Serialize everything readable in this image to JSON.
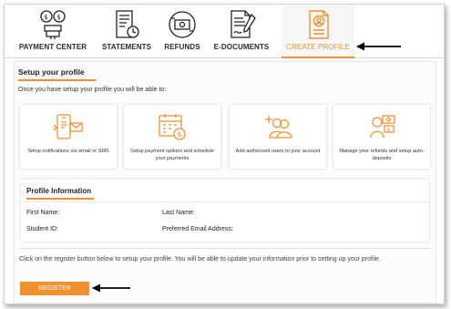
{
  "tabs": [
    {
      "label": "PAYMENT CENTER",
      "icon": "payment-center-icon"
    },
    {
      "label": "STATEMENTS",
      "icon": "statements-icon"
    },
    {
      "label": "REFUNDS",
      "icon": "refunds-icon"
    },
    {
      "label": "E-DOCUMENTS",
      "icon": "e-documents-icon"
    },
    {
      "label": "CREATE PROFILE",
      "icon": "create-profile-icon",
      "active": true
    }
  ],
  "setup": {
    "title": "Setup your profile",
    "intro": "Once you have setup your profile you will be able to:",
    "cards": [
      {
        "text": "Setup notifications via email or SMS",
        "icon": "notifications-icon"
      },
      {
        "text": "Setup payment options and schedule your payments",
        "icon": "calendar-payment-icon"
      },
      {
        "text": "Add authorized users to your account",
        "icon": "add-users-icon"
      },
      {
        "text": "Manage your refunds and setup auto-deposits",
        "icon": "refund-manage-icon"
      }
    ]
  },
  "profile": {
    "title": "Profile Information",
    "first_name": "First Name:",
    "last_name": "Last Name:",
    "student_id": "Student ID:",
    "preferred_email": "Preferred Email Address:"
  },
  "note": "Click on the register button below to setup your profile. You will be able to update your information prior to setting up your profile.",
  "register_label": "REGISTER",
  "colors": {
    "accent": "#f0912e",
    "text": "#2b2b2b"
  }
}
